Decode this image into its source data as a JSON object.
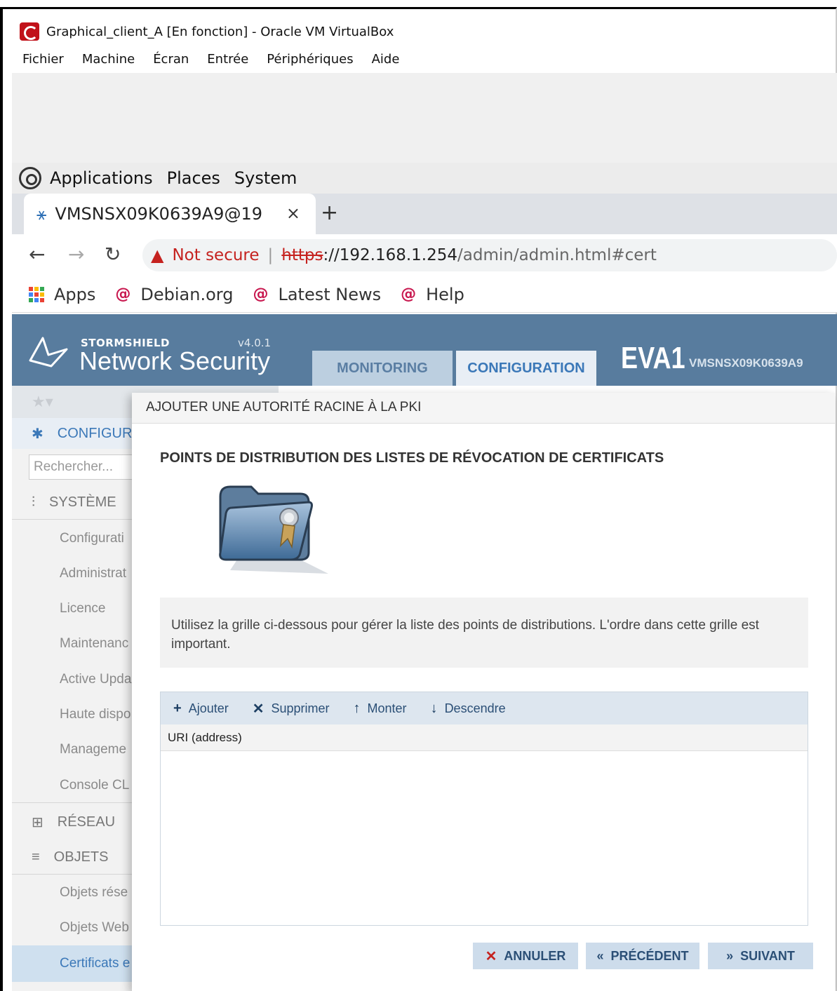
{
  "vbox": {
    "title": "Graphical_client_A [En fonction] - Oracle VM VirtualBox",
    "menu": [
      "Fichier",
      "Machine",
      "Écran",
      "Entrée",
      "Périphériques",
      "Aide"
    ]
  },
  "gnome": {
    "items": [
      "Applications",
      "Places",
      "System"
    ]
  },
  "browser": {
    "tab_title": "VMSNSX09K0639A9@19",
    "tab_close": "×",
    "new_tab": "+",
    "not_secure": "Not secure",
    "url_scheme": "https",
    "url_host": "://192.168.1.254",
    "url_path": "/admin/admin.html#cert",
    "bookmarks": [
      "Apps",
      "Debian.org",
      "Latest News",
      "Help"
    ]
  },
  "app": {
    "brand": "STORMSHIELD",
    "product": "Network Security",
    "version": "v4.0.1",
    "tabs": [
      "MONITORING",
      "CONFIGURATION"
    ],
    "device": "EVA1",
    "serial": "VMSNSX09K0639A9"
  },
  "sidebar": {
    "config_label": "CONFIGURA",
    "search_placeholder": "Rechercher...",
    "systeme": "SYSTÈME",
    "systeme_items": [
      "Configurati",
      "Administrat",
      "Licence",
      "Maintenanc",
      "Active Upda",
      "Haute dispo",
      "Manageme",
      "Console CL"
    ],
    "reseau": "RÉSEAU",
    "objets": "OBJETS",
    "objets_items": [
      "Objets rése",
      "Objets Web",
      "Certificats e"
    ]
  },
  "dialog": {
    "title": "AJOUTER UNE AUTORITÉ RACINE À LA PKI",
    "section": "POINTS DE DISTRIBUTION DES LISTES DE RÉVOCATION DE CERTIFICATS",
    "info": "Utilisez la grille ci-dessous pour gérer la liste des points de distributions. L'ordre dans cette grille est important.",
    "toolbar": {
      "add": "Ajouter",
      "delete": "Supprimer",
      "up": "Monter",
      "down": "Descendre"
    },
    "column": "URI (address)",
    "buttons": {
      "cancel": "ANNULER",
      "prev": "PRÉCÉDENT",
      "next": "SUIVANT"
    }
  },
  "colors": {
    "header": "#587c9e",
    "accent": "#3b78b8",
    "danger": "#c5221f"
  }
}
